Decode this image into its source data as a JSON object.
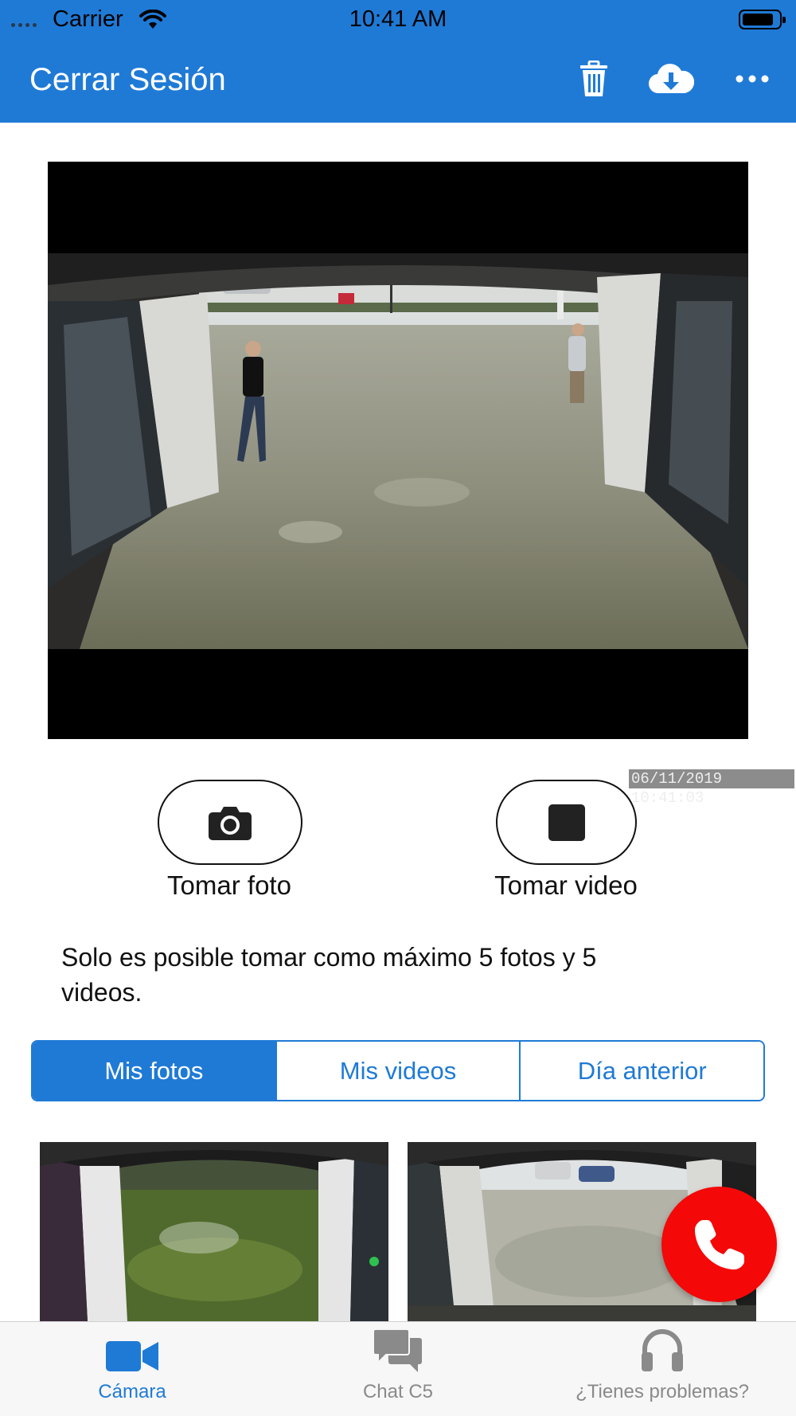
{
  "status_bar": {
    "carrier": "Carrier",
    "time": "10:41 AM"
  },
  "nav": {
    "title": "Cerrar Sesión",
    "icons": [
      "trash-icon",
      "cloud-download-icon",
      "more-icon"
    ]
  },
  "video": {
    "timestamp": "06/11/2019 10:41:03"
  },
  "capture": {
    "photo_label": "Tomar foto",
    "video_label": "Tomar video"
  },
  "notice": "Solo es posible tomar como máximo 5 fotos y 5 videos.",
  "segments": [
    {
      "label": "Mis fotos",
      "active": true
    },
    {
      "label": "Mis videos",
      "active": false
    },
    {
      "label": "Día anterior",
      "active": false
    }
  ],
  "tabs": [
    {
      "label": "Cámara",
      "icon": "video-camera-icon",
      "active": true
    },
    {
      "label": "Chat C5",
      "icon": "chat-icon",
      "active": false
    },
    {
      "label": "¿Tienes problemas?",
      "icon": "headphones-icon",
      "active": false
    }
  ],
  "colors": {
    "brand": "#1f7ad6",
    "call": "#f40808",
    "tab_inactive": "#8a8a8a"
  }
}
